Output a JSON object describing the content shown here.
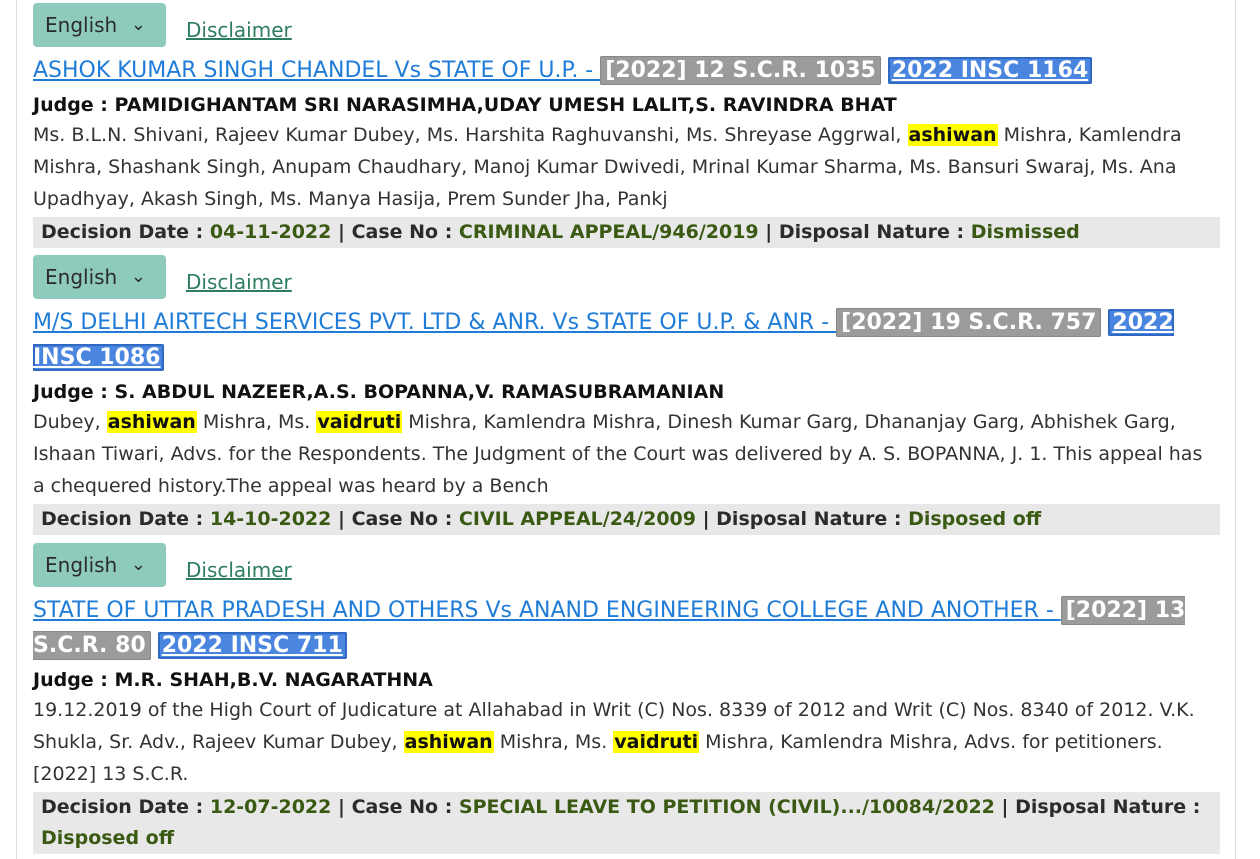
{
  "results": [
    {
      "language": "English",
      "disclaimer": "Disclaimer",
      "title": "ASHOK KUMAR SINGH CHANDEL Vs STATE OF U.P. - ",
      "scr": "[2022] 12 S.C.R. 1035",
      "insc": "2022 INSC 1164",
      "judge_label": "Judge : ",
      "judges": "PAMIDIGHANTAM SRI NARASIMHA,UDAY UMESH LALIT,S. RAVINDRA BHAT",
      "snippet": [
        {
          "t": "Ms. B.L.N. Shivani, Rajeev Kumar Dubey, Ms. Harshita Raghuvanshi, Ms. Shreyase Aggrwal, "
        },
        {
          "t": "ashiwan",
          "hl": true
        },
        {
          "t": " Mishra, Kamlendra Mishra, Shashank Singh, Anupam Chaudhary, Manoj Kumar Dwivedi, Mrinal Kumar Sharma, Ms. Bansuri Swaraj, Ms. Ana Upadhyay, Akash Singh, Ms. Manya Hasija, Prem Sunder Jha, Pankj"
        }
      ],
      "decision_label": "Decision Date : ",
      "decision_date": "04-11-2022",
      "case_label": "Case No : ",
      "case_no": "CRIMINAL APPEAL/946/2019",
      "disposal_label": "Disposal Nature : ",
      "disposal": "Dismissed"
    },
    {
      "language": "English",
      "disclaimer": "Disclaimer",
      "title": "M/S DELHI AIRTECH SERVICES PVT. LTD & ANR. Vs STATE OF U.P. & ANR - ",
      "scr": "[2022] 19 S.C.R. 757",
      "insc": "2022 INSC 1086",
      "judge_label": "Judge : ",
      "judges": "S. ABDUL NAZEER,A.S. BOPANNA,V. RAMASUBRAMANIAN",
      "snippet": [
        {
          "t": "Dubey, "
        },
        {
          "t": "ashiwan",
          "hl": true
        },
        {
          "t": " Mishra, Ms. "
        },
        {
          "t": "vaidruti",
          "hl": true
        },
        {
          "t": " Mishra, Kamlendra Mishra, Dinesh Kumar Garg, Dhananjay Garg, Abhishek Garg, Ishaan Tiwari, Advs. for the Respondents. The Judgment of the Court was delivered by A. S. BOPANNA, J. 1. This appeal has a chequered history.The appeal was heard by a Bench"
        }
      ],
      "decision_label": "Decision Date : ",
      "decision_date": "14-10-2022",
      "case_label": "Case No : ",
      "case_no": "CIVIL APPEAL/24/2009",
      "disposal_label": "Disposal Nature : ",
      "disposal": "Disposed off"
    },
    {
      "language": "English",
      "disclaimer": "Disclaimer",
      "title": "STATE OF UTTAR PRADESH AND OTHERS Vs ANAND ENGINEERING COLLEGE AND ANOTHER - ",
      "scr": "[2022] 13 S.C.R. 80",
      "insc": "2022 INSC 711",
      "judge_label": "Judge : ",
      "judges": "M.R. SHAH,B.V. NAGARATHNA",
      "snippet": [
        {
          "t": "19.12.2019 of the High Court of Judicature at Allahabad in Writ (C) Nos. 8339 of 2012 and Writ (C) Nos. 8340 of 2012. V.K. Shukla, Sr. Adv., Rajeev Kumar Dubey, "
        },
        {
          "t": "ashiwan",
          "hl": true
        },
        {
          "t": " Mishra, Ms. "
        },
        {
          "t": "vaidruti",
          "hl": true
        },
        {
          "t": " Mishra, Kamlendra Mishra, Advs. for petitioners. [2022] 13 S.C.R."
        }
      ],
      "decision_label": "Decision Date : ",
      "decision_date": "12-07-2022",
      "case_label": "Case No : ",
      "case_no": "SPECIAL LEAVE TO PETITION (CIVIL).../10084/2022",
      "disposal_label": "Disposal Nature : ",
      "disposal": "Disposed off"
    }
  ],
  "icons": {
    "dropdown": "chevron-down-icon"
  }
}
